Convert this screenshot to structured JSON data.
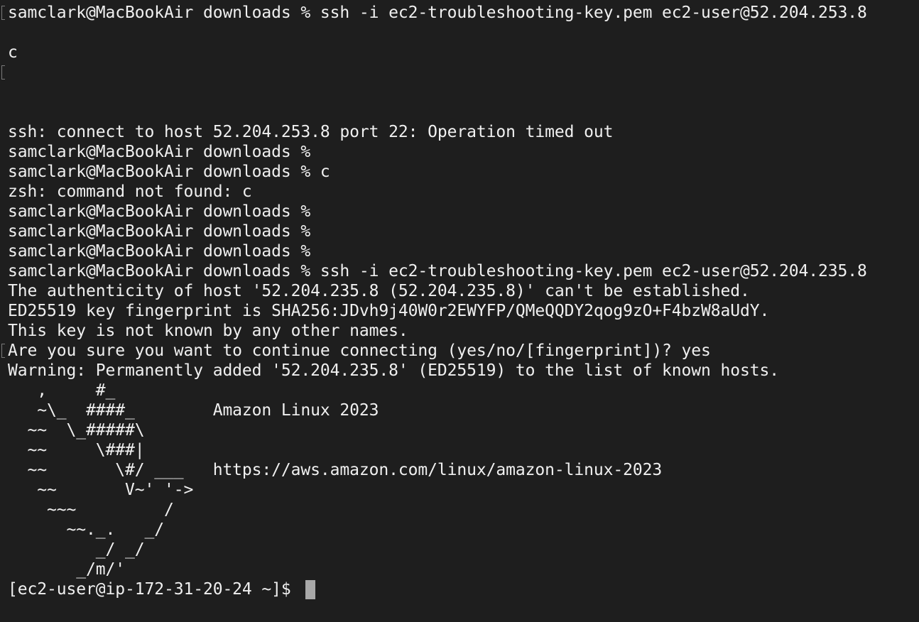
{
  "terminal": {
    "lines": [
      "samclark@MacBookAir downloads % ssh -i ec2-troubleshooting-key.pem ec2-user@52.204.253.8",
      "c",
      "ssh: connect to host 52.204.253.8 port 22: Operation timed out",
      "samclark@MacBookAir downloads %",
      "samclark@MacBookAir downloads % c",
      "zsh: command not found: c",
      "samclark@MacBookAir downloads %",
      "samclark@MacBookAir downloads %",
      "samclark@MacBookAir downloads %",
      "samclark@MacBookAir downloads % ssh -i ec2-troubleshooting-key.pem ec2-user@52.204.235.8",
      "The authenticity of host '52.204.235.8 (52.204.235.8)' can't be established.",
      "ED25519 key fingerprint is SHA256:JDvh9j40W0r2EWYFP/QMeQQDY2qog9zO+F4bzW8aUdY.",
      "This key is not known by any other names.",
      "Are you sure you want to continue connecting (yes/no/[fingerprint])? yes",
      "Warning: Permanently added '52.204.235.8' (ED25519) to the list of known hosts.",
      "   ,     #_",
      "   ~\\_  ####_        Amazon Linux 2023",
      "  ~~  \\_#####\\",
      "  ~~     \\###|",
      "  ~~       \\#/ ___   https://aws.amazon.com/linux/amazon-linux-2023",
      "   ~~       V~' '->",
      "    ~~~         /",
      "      ~~._.   _/",
      "         _/ _/",
      "       _/m/'",
      "[ec2-user@ip-172-31-20-24 ~]$"
    ]
  }
}
